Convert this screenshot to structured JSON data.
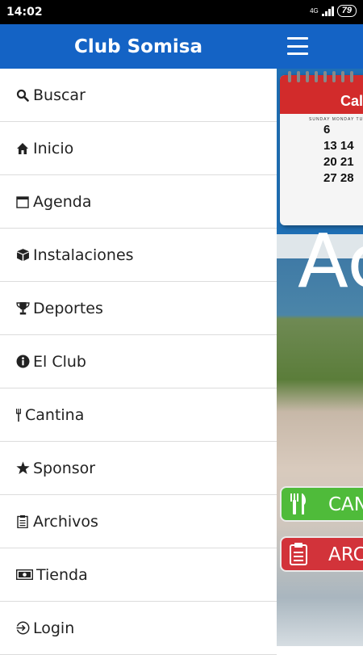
{
  "status_bar": {
    "time": "14:02",
    "network": "4G",
    "battery": "79"
  },
  "drawer": {
    "title": "Club Somisa",
    "items": [
      {
        "label": "Buscar",
        "icon": "search-icon"
      },
      {
        "label": "Inicio",
        "icon": "home-icon"
      },
      {
        "label": "Agenda",
        "icon": "calendar-icon"
      },
      {
        "label": "Instalaciones",
        "icon": "cube-icon"
      },
      {
        "label": "Deportes",
        "icon": "trophy-icon"
      },
      {
        "label": "El Club",
        "icon": "info-icon"
      },
      {
        "label": "Cantina",
        "icon": "fork-icon"
      },
      {
        "label": "Sponsor",
        "icon": "star-icon"
      },
      {
        "label": "Archivos",
        "icon": "clipboard-icon"
      },
      {
        "label": "Tienda",
        "icon": "money-icon"
      },
      {
        "label": "Login",
        "icon": "login-icon"
      }
    ]
  },
  "background": {
    "calendar_header": "Cal",
    "calendar_days": "SUNDAY MONDAY TUESDA",
    "calendar_numbers": [
      "6",
      "13 14",
      "20 21",
      "27 28"
    ],
    "banner_text": "Ac",
    "cantina_button": "CAN",
    "archivos_button": "ARC"
  },
  "colors": {
    "primary": "#1463c5",
    "cantina": "#4fbb3a",
    "archivos": "#d2333a"
  }
}
